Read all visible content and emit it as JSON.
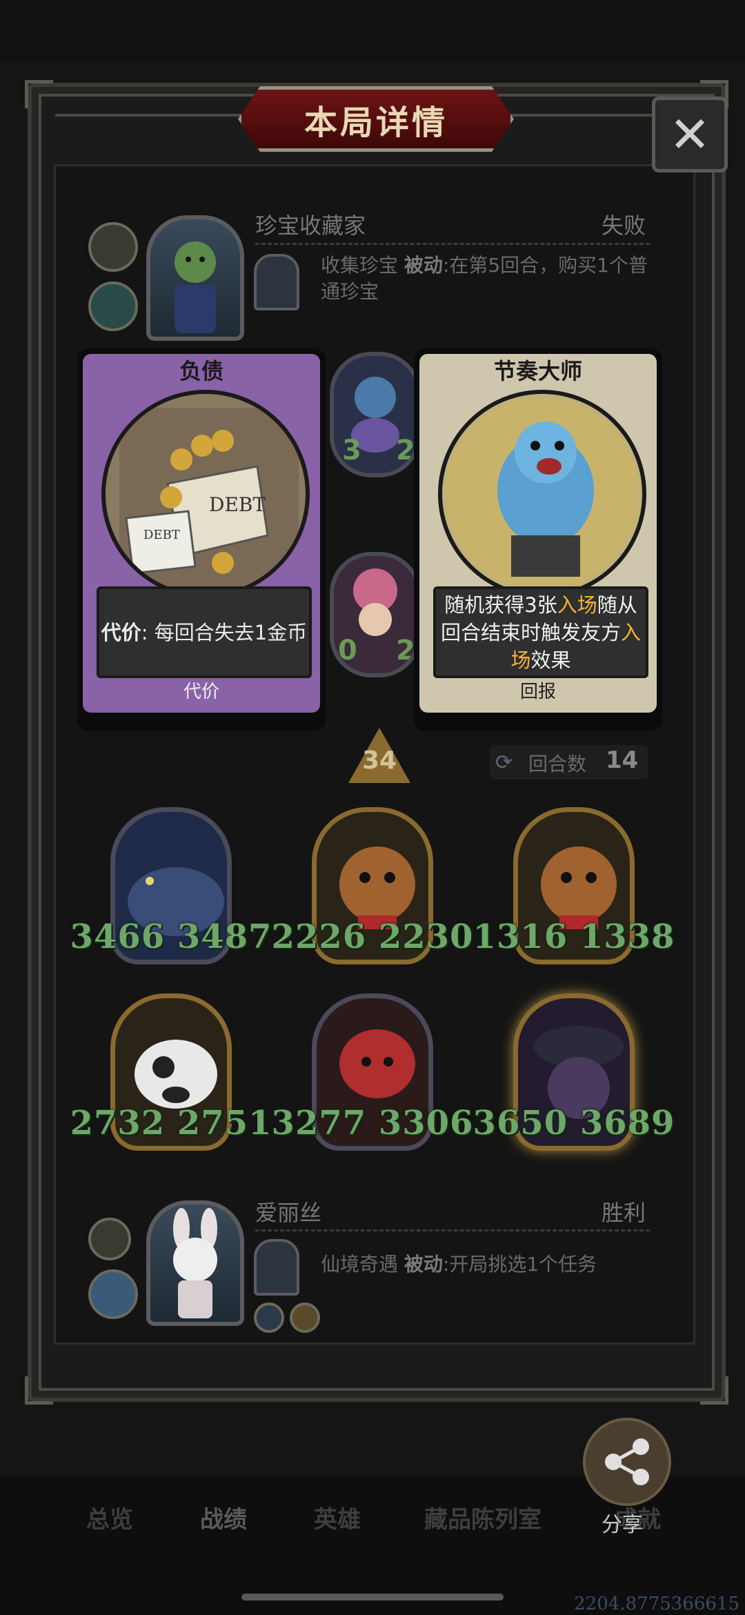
{
  "header": {
    "title": "本局详情",
    "close_glyph": "✕"
  },
  "player_top": {
    "name": "珍宝收藏家",
    "result": "失败",
    "skill_name": "收集珍宝",
    "skill_type": "被动",
    "skill_desc": ":在第5回合，购买1个普通珍宝"
  },
  "player_bottom": {
    "name": "爱丽丝",
    "result": "胜利",
    "skill_name": "仙境奇遇",
    "skill_type": "被动",
    "skill_desc": ":开局挑选1个任务"
  },
  "card_left": {
    "title": "负债",
    "desc_bold": "代价",
    "desc_rest": ": 每回合失去1金币",
    "tag": "代价",
    "art_text_1": "DEBT",
    "art_text_2": "DEBT",
    "color": "#8a62a8"
  },
  "card_right": {
    "title": "节奏大师",
    "desc_1": "随机获得3张",
    "desc_kw1": "入场",
    "desc_2": "随从回合结束时触发友方",
    "desc_kw2": "入场",
    "desc_3": "效果",
    "tag": "回报",
    "color": "#cfc7ad"
  },
  "middle_minions": [
    {
      "left": "3",
      "right": "2"
    },
    {
      "left": "0",
      "right": "2"
    }
  ],
  "round": {
    "arrow_value": "34",
    "label": "回合数",
    "count": "14"
  },
  "minions": [
    {
      "stats": "3466 3487"
    },
    {
      "stats": "2226 2230"
    },
    {
      "stats": "1316 1338"
    },
    {
      "stats": "2732 2751"
    },
    {
      "stats": "3277 3306"
    },
    {
      "stats": "3650 3689"
    }
  ],
  "share": {
    "label": "分享"
  },
  "bottom_nav": [
    "总览",
    "战绩",
    "英雄",
    "藏品陈列室",
    "成就"
  ],
  "watermark": "2204.8775366615",
  "colors": {
    "accent_gold": "#f3b335",
    "stat_green": "#6fa66a",
    "banner_red": "#6e1414"
  }
}
